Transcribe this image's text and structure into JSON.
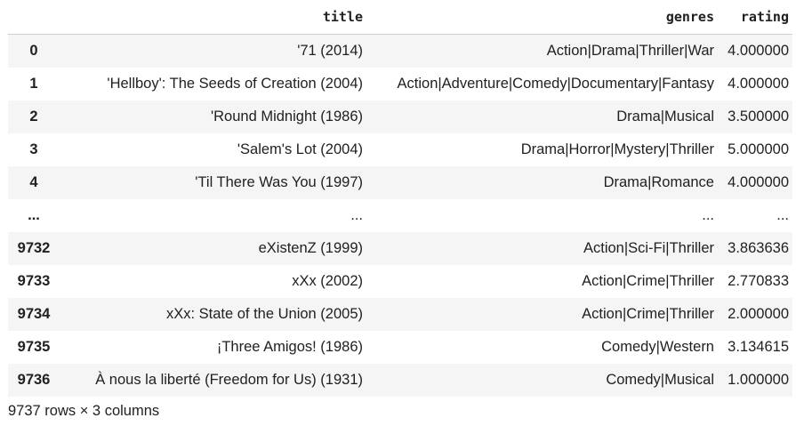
{
  "table": {
    "columns": [
      "title",
      "genres",
      "rating"
    ],
    "rows": [
      {
        "index": "0",
        "title": "'71 (2014)",
        "genres": "Action|Drama|Thriller|War",
        "rating": "4.000000"
      },
      {
        "index": "1",
        "title": "'Hellboy': The Seeds of Creation (2004)",
        "genres": "Action|Adventure|Comedy|Documentary|Fantasy",
        "rating": "4.000000"
      },
      {
        "index": "2",
        "title": "'Round Midnight (1986)",
        "genres": "Drama|Musical",
        "rating": "3.500000"
      },
      {
        "index": "3",
        "title": "'Salem's Lot (2004)",
        "genres": "Drama|Horror|Mystery|Thriller",
        "rating": "5.000000"
      },
      {
        "index": "4",
        "title": "'Til There Was You (1997)",
        "genres": "Drama|Romance",
        "rating": "4.000000"
      },
      {
        "index": "...",
        "title": "...",
        "genres": "...",
        "rating": "..."
      },
      {
        "index": "9732",
        "title": "eXistenZ (1999)",
        "genres": "Action|Sci-Fi|Thriller",
        "rating": "3.863636"
      },
      {
        "index": "9733",
        "title": "xXx (2002)",
        "genres": "Action|Crime|Thriller",
        "rating": "2.770833"
      },
      {
        "index": "9734",
        "title": "xXx: State of the Union (2005)",
        "genres": "Action|Crime|Thriller",
        "rating": "2.000000"
      },
      {
        "index": "9735",
        "title": "¡Three Amigos! (1986)",
        "genres": "Comedy|Western",
        "rating": "3.134615"
      },
      {
        "index": "9736",
        "title": "À nous la liberté (Freedom for Us) (1931)",
        "genres": "Comedy|Musical",
        "rating": "1.000000"
      }
    ]
  },
  "summary": "9737 rows × 3 columns"
}
